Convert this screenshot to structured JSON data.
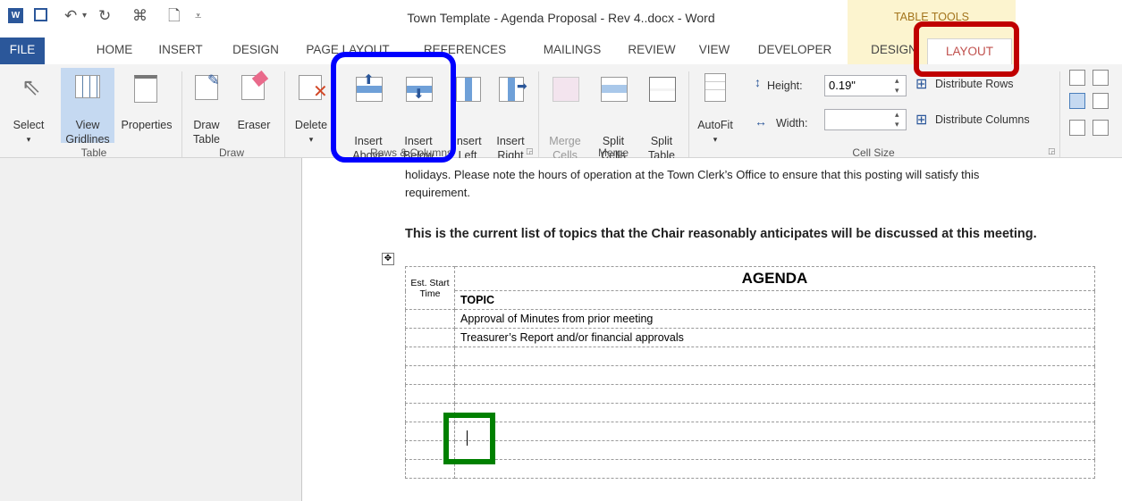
{
  "window": {
    "title": "Town Template - Agenda Proposal - Rev 4..docx - Word",
    "contextual_group": "TABLE TOOLS"
  },
  "tabs": {
    "file": "FILE",
    "home": "HOME",
    "insert": "INSERT",
    "design": "DESIGN",
    "page_layout": "PAGE LAYOUT",
    "references": "REFERENCES",
    "mailings": "MAILINGS",
    "review": "REVIEW",
    "view": "VIEW",
    "developer": "DEVELOPER",
    "table_design": "DESIGN",
    "table_layout": "LAYOUT"
  },
  "ribbon": {
    "table_group": {
      "label": "Table",
      "select": "Select",
      "view_gridlines_1": "View",
      "view_gridlines_2": "Gridlines",
      "properties": "Properties"
    },
    "draw_group": {
      "label": "Draw",
      "draw_table_1": "Draw",
      "draw_table_2": "Table",
      "eraser": "Eraser"
    },
    "rows_cols_group": {
      "label": "Rows & Columns",
      "delete": "Delete",
      "insert_above_1": "Insert",
      "insert_above_2": "Above",
      "insert_below_1": "Insert",
      "insert_below_2": "Below",
      "insert_left_1": "Insert",
      "insert_left_2": "Left",
      "insert_right_1": "Insert",
      "insert_right_2": "Right"
    },
    "merge_group": {
      "label": "Merge",
      "merge_cells_1": "Merge",
      "merge_cells_2": "Cells",
      "split_cells_1": "Split",
      "split_cells_2": "Cells",
      "split_table_1": "Split",
      "split_table_2": "Table"
    },
    "cell_size_group": {
      "label": "Cell Size",
      "autofit": "AutoFit",
      "height_label": "Height:",
      "height_value": "0.19\"",
      "width_label": "Width:",
      "width_value": "",
      "distribute_rows": "Distribute Rows",
      "distribute_columns": "Distribute Columns"
    }
  },
  "document": {
    "para1_line1": "holidays.  Please note the hours of operation at the Town Clerk’s Office to ensure that this posting will satisfy this",
    "para1_line2": "requirement.",
    "heading": "This is the current list of topics that the Chair reasonably anticipates will be discussed at this meeting.",
    "table": {
      "col1_header": "Est. Start Time",
      "agenda_title": "AGENDA",
      "topic_header": "TOPIC",
      "rows": [
        "Approval of Minutes from prior meeting",
        "Treasurer’s Report and/or financial approvals",
        "",
        "",
        "",
        "",
        "",
        "",
        ""
      ]
    }
  },
  "colors": {
    "file_tab": "#2b579a",
    "highlight_blue": "#0000ff",
    "highlight_red": "#c00000",
    "highlight_green": "#008000",
    "table_tools_bg": "#fcf4cf"
  }
}
